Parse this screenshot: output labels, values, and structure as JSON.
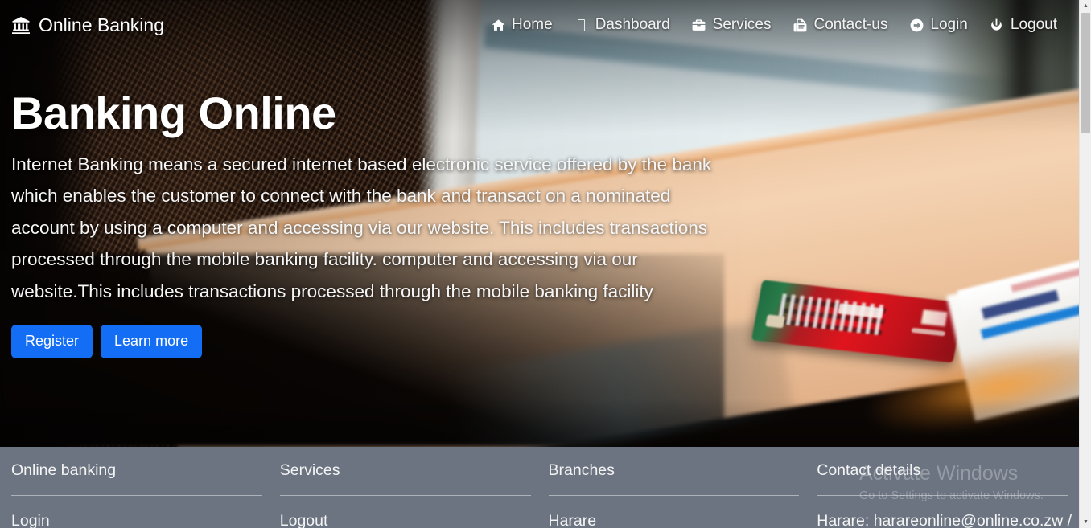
{
  "brand": {
    "name": "Online Banking",
    "icon": "bank-icon"
  },
  "nav": {
    "items": [
      {
        "label": "Home",
        "icon": "home-icon"
      },
      {
        "label": "Dashboard",
        "icon": "missing-glyph-icon"
      },
      {
        "label": "Services",
        "icon": "toolbox-icon"
      },
      {
        "label": "Contact-us",
        "icon": "fax-icon"
      },
      {
        "label": "Login",
        "icon": "arrow-circle-right-icon"
      },
      {
        "label": "Logout",
        "icon": "power-icon"
      }
    ]
  },
  "hero": {
    "title": "Banking Online",
    "paragraph": "Internet Banking means a secured internet based electronic service offered by the bank which enables the customer to connect with the bank and transact on a nominated account by using a computer and accessing via our website. This includes transactions processed through the mobile banking facility. computer and accessing via our website.This includes transactions processed through the mobile banking facility",
    "primary_button": "Register",
    "secondary_button": "Learn more",
    "button_color": "#146ef5"
  },
  "footer": {
    "background_color": "#6b7480",
    "columns": [
      {
        "heading": "Online banking",
        "link": "Login"
      },
      {
        "heading": "Services",
        "link": "Logout"
      },
      {
        "heading": "Branches",
        "link": "Harare"
      },
      {
        "heading": "Contact details",
        "link": "Harare: harareonline@online.co.zw /"
      }
    ]
  },
  "watermark": {
    "title": "Activate Windows",
    "subtitle": "Go to Settings to activate Windows."
  },
  "scrollbar": {
    "up_arrow": "▲",
    "down_arrow": "▼"
  }
}
